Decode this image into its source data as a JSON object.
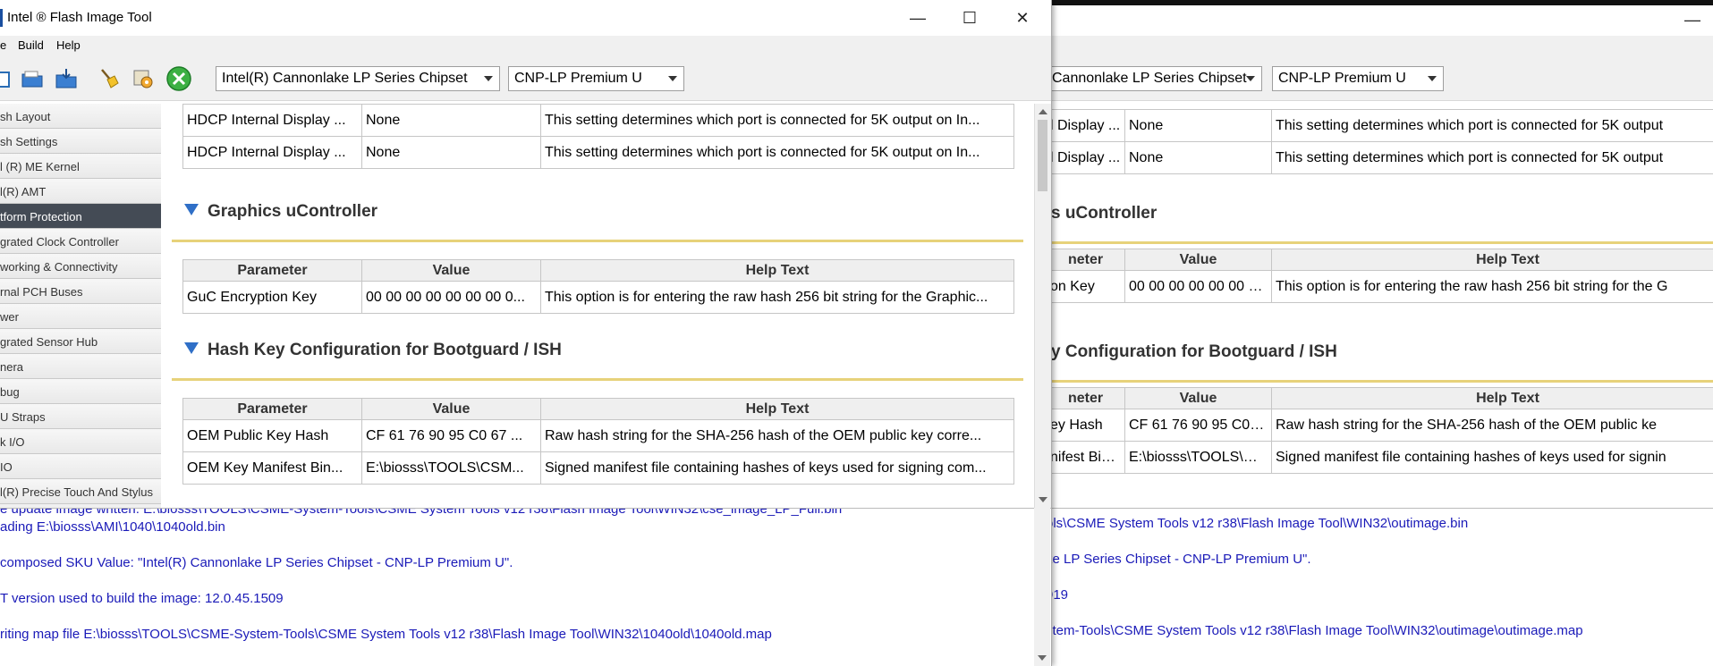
{
  "window": {
    "title": "Intel ® Flash Image Tool",
    "minimize": "—",
    "maximize": "☐",
    "close": "✕"
  },
  "menu": {
    "file": "e",
    "build": "Build",
    "help": "Help"
  },
  "toolbar": {
    "chipset": "Intel(R) Cannonlake LP Series Chipset",
    "sku": "CNP-LP Premium U",
    "chipset_back": "Cannonlake LP Series Chipset"
  },
  "sidebar": {
    "items": [
      "sh Layout",
      "sh Settings",
      "l (R) ME Kernel",
      "l(R) AMT",
      "tform Protection",
      "grated Clock Controller",
      "working & Connectivity",
      "rnal PCH Buses",
      "wer",
      "grated Sensor Hub",
      "nera",
      "bug",
      "U Straps",
      "k I/O",
      "IO",
      "l(R) Precise Touch And Stylus"
    ],
    "selected_index": 4
  },
  "top_rows": [
    {
      "param": "HDCP Internal Display ...",
      "value": "None",
      "help": "This setting determines which port  is connected  for 5K output on In..."
    },
    {
      "param": "HDCP Internal Display ...",
      "value": "None",
      "help": "This setting determines which port  is connected  for 5K output on In..."
    }
  ],
  "sections": {
    "guc": {
      "title": "Graphics uController",
      "headers": {
        "param": "Parameter",
        "value": "Value",
        "help": "Help Text"
      },
      "rows": [
        {
          "param": "GuC Encryption Key",
          "value": "00 00 00 00 00 00 00 0...",
          "help": "This option is for entering the raw hash 256 bit string for the Graphic..."
        }
      ]
    },
    "hash": {
      "title": "Hash Key Configuration for Bootguard / ISH",
      "headers": {
        "param": "Parameter",
        "value": "Value",
        "help": "Help Text"
      },
      "rows": [
        {
          "param": "OEM Public Key Hash",
          "value": "CF 61 76 90 95 C0 67 ...",
          "help": "Raw hash string for the SHA-256 hash of the OEM public key corre..."
        },
        {
          "param": "OEM Key Manifest Bin...",
          "value": "E:\\biosss\\TOOLS\\CSM...",
          "help": "Signed manifest file containing hashes of keys used for signing  com..."
        }
      ]
    }
  },
  "log": [
    "ading E:\\biosss\\AMI\\1040\\1040old.bin",
    "composed SKU Value: \"Intel(R) Cannonlake LP Series Chipset - CNP-LP Premium U\".",
    "T version used to build the image: 12.0.45.1509",
    "riting map file E:\\biosss\\TOOLS\\CSME-System-Tools\\CSME System Tools v12 r38\\Flash Image Tool\\WIN32\\1040old\\1040old.map"
  ],
  "log_partial": "e update image written: E:\\biosss\\TOOLS\\CSME-System-Tools\\CSME System Tools v12 r38\\Flash Image Tool\\WIN32\\cse_image_LP_Full.bin",
  "back": {
    "top_rows": [
      {
        "param": "l Display ...",
        "value": "None",
        "help": "This setting determines which port  is connected  for 5K output"
      },
      {
        "param": "l Display ...",
        "value": "None",
        "help": "This setting determines which port  is connected  for 5K output"
      }
    ],
    "guc_title": "s uController",
    "guc_headers": {
      "param": "neter",
      "value": "Value",
      "help": "Help Text"
    },
    "guc_rows": [
      {
        "param": "on Key",
        "value": "00 00 00 00 00 00 00 0...",
        "help": "This option is for entering the raw hash 256 bit string for the G"
      }
    ],
    "hash_title": "y Configuration for Bootguard / ISH",
    "hash_headers": {
      "param": "neter",
      "value": "Value",
      "help": "Help Text"
    },
    "hash_rows": [
      {
        "param": "ey Hash",
        "value": "CF 61 76 90 95 C0 67 ...",
        "help": "Raw hash string for the SHA-256 hash of the OEM public ke"
      },
      {
        "param": "nifest Bin...",
        "value": "E:\\biosss\\TOOLS\\CSM...",
        "help": "Signed manifest file containing hashes of keys used for signin"
      }
    ],
    "log": [
      "ols\\CSME System Tools v12 r38\\Flash Image Tool\\WIN32\\outimage.bin",
      "ke LP Series Chipset - CNP-LP Premium U\".",
      "919",
      "stem-Tools\\CSME System Tools v12 r38\\Flash Image Tool\\WIN32\\outimage\\outimage.map"
    ]
  }
}
